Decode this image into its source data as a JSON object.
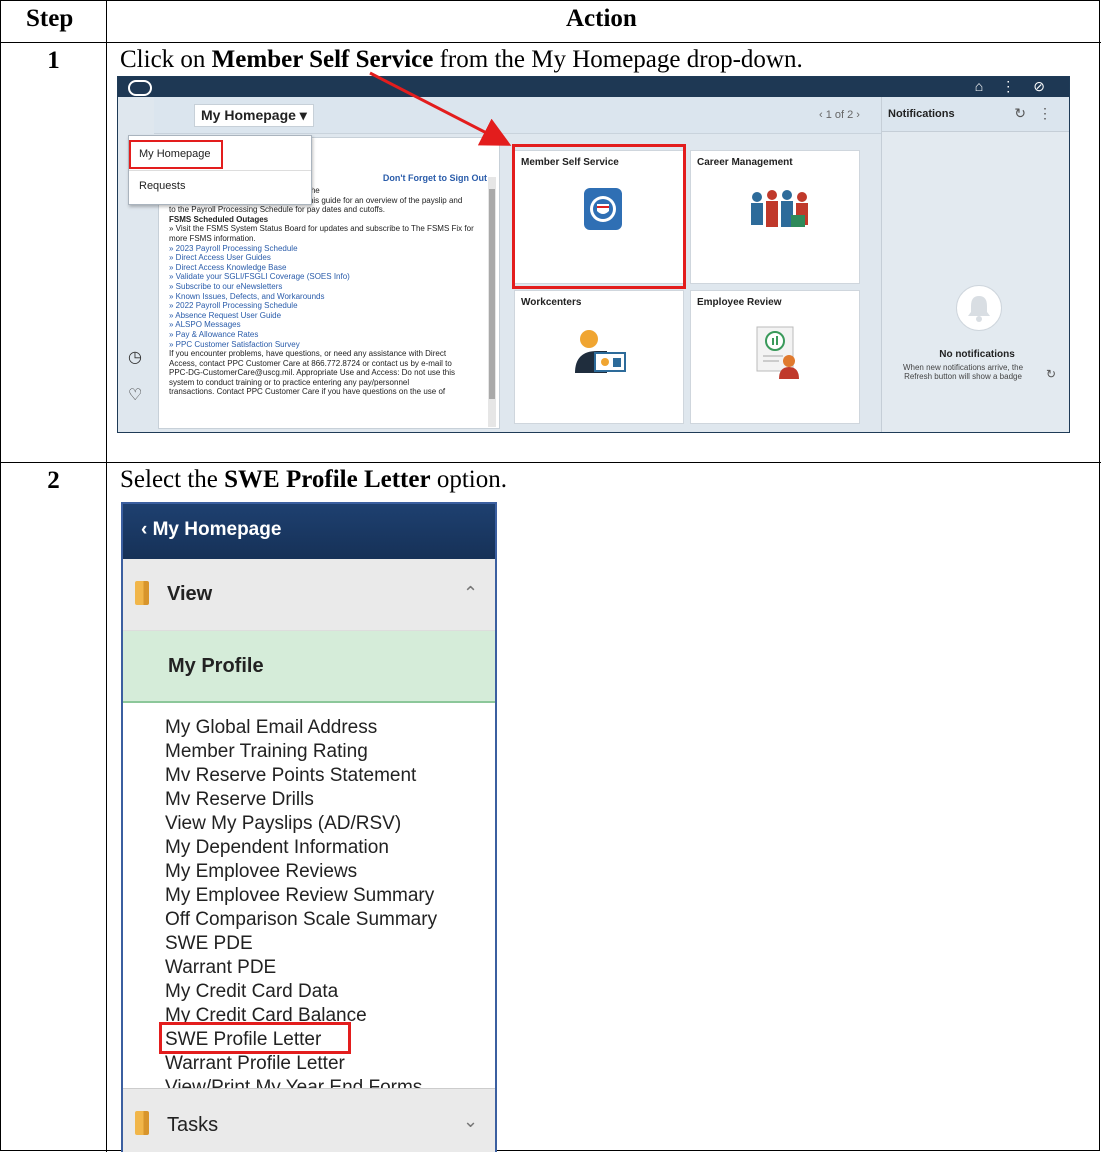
{
  "table": {
    "headers": [
      "Step",
      "Action"
    ],
    "rows": [
      {
        "step": "1",
        "text_before": "Click on ",
        "bold": "Member Self Service",
        "text_after": " from the My Homepage drop-down."
      },
      {
        "step": "2",
        "text_before": "Select the ",
        "bold": "SWE Profile Letter",
        "text_after": " option."
      }
    ]
  },
  "screenshot1": {
    "homepage_button": "My Homepage ▾",
    "pager": "‹   1 of 2   ›",
    "dropdown_items": [
      "My Homepage",
      "Requests"
    ],
    "notice_heading": "Don't Forget to Sign Out",
    "notice_lines": [
      {
        "text": "r to each pay date.  Access payslips via the",
        "link": false
      },
      {
        "text": "Self Service - View - Member Rates to this guide for an overview of the payslip and",
        "link": false
      },
      {
        "text": "to the Payroll Processing Schedule for pay dates and cutoffs.",
        "link": false
      },
      {
        "text": "FSMS Scheduled Outages",
        "link": false,
        "bold": true
      },
      {
        "text": "» Visit the  FSMS System Status Board for updates and subscribe to The FSMS Fix for",
        "link": false
      },
      {
        "text": "more FSMS information.",
        "link": false
      },
      {
        "text": "» 2023 Payroll Processing Schedule",
        "link": true
      },
      {
        "text": "» Direct Access User Guides",
        "link": true
      },
      {
        "text": "» Direct Access Knowledge Base",
        "link": true
      },
      {
        "text": "» Validate your SGLI/FSGLI Coverage (SOES Info)",
        "link": true
      },
      {
        "text": "» Subscribe to our eNewsletters",
        "link": true
      },
      {
        "text": "» Known Issues, Defects, and Workarounds",
        "link": true
      },
      {
        "text": "» 2022 Payroll Processing Schedule",
        "link": true
      },
      {
        "text": "» Absence Request User Guide",
        "link": true
      },
      {
        "text": "» ALSPO Messages",
        "link": true
      },
      {
        "text": "» Pay & Allowance Rates",
        "link": true
      },
      {
        "text": "» PPC Customer Satisfaction Survey",
        "link": true
      },
      {
        "text": "If you encounter problems, have questions, or need any assistance with Direct",
        "link": false
      },
      {
        "text": "Access, contact PPC Customer Care at 866.772.8724 or contact us by e-mail to",
        "link": false
      },
      {
        "text": "PPC-DG-CustomerCare@uscg.mil. Appropriate Use and Access: Do not use this",
        "link": false
      },
      {
        "text": "system to conduct training or to practice entering any pay/personnel",
        "link": false
      },
      {
        "text": "transactions. Contact PPC Customer Care if you have questions on the use of",
        "link": false
      }
    ],
    "tiles": [
      "Member Self Service",
      "Career Management",
      "Workcenters",
      "Employee Review"
    ],
    "notifications": {
      "title": "Notifications",
      "empty_title": "No notifications",
      "empty_sub": "When new notifications arrive, the Refresh button will show a badge"
    },
    "colors": {
      "topbar": "#1e3854",
      "highlight": "#e31d1d"
    }
  },
  "screenshot2": {
    "header": "‹  My Homepage",
    "view_label": "View",
    "my_profile": "My Profile",
    "items": [
      "My Global Email Address",
      "Member Training Rating",
      "Mv Reserve Points Statement",
      "Mv Reserve Drills",
      "View My Payslips (AD/RSV)",
      "My Dependent Information",
      "My Emplovee Reviews",
      "My Emplovee Review Summary",
      "Off Comparison Scale Summary",
      "SWE PDE",
      "Warrant PDE",
      "My Credit Card Data",
      "My Credit Card Balance",
      "SWE Profile Letter",
      "Warrant Profile Letter",
      "View/Print My Year End Forms"
    ],
    "tasks_label": "Tasks",
    "colors": {
      "header": "#1e4070",
      "profile_bg": "#d5ecd9",
      "highlight": "#e31d1d"
    }
  }
}
